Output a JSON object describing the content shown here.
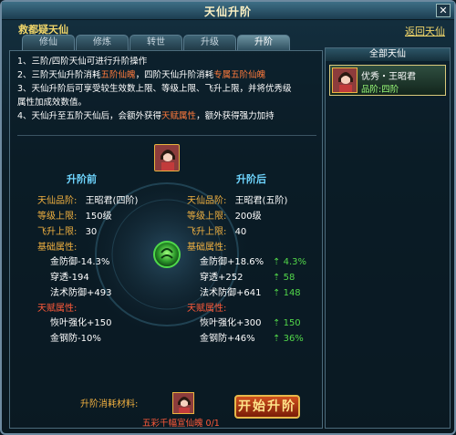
{
  "window": {
    "title": "天仙升阶",
    "close_glyph": "✕"
  },
  "header": {
    "label": "救都疑天仙",
    "return_link": "返回天仙"
  },
  "tabs": [
    {
      "label": "修仙"
    },
    {
      "label": "修炼"
    },
    {
      "label": "转世"
    },
    {
      "label": "升级"
    },
    {
      "label": "升阶"
    }
  ],
  "rules": [
    {
      "a": "1、三阶/四阶天仙可进行升阶操作",
      "hl": "",
      "c": ""
    },
    {
      "a": "2、三阶天仙升阶消耗",
      "hl": "五阶仙魄",
      "c": "，四阶天仙升阶消耗",
      "hl2": "专属五阶仙魄"
    },
    {
      "a": "3、天仙升阶后可享受较生效数上限、等级上限、飞升上限，并将优秀级",
      "hl": "",
      "c": ""
    },
    {
      "a": "属性加成效数值。",
      "hl": "",
      "c": ""
    },
    {
      "a": "4、天仙升至五阶天仙后，会额外获得",
      "hl": "天赋属性",
      "c": "，额外获得强力加持"
    }
  ],
  "before": {
    "header": "升阶前",
    "rows": [
      {
        "label": "天仙品阶:",
        "value": "王昭君(四阶)"
      },
      {
        "label": "等级上限:",
        "value": "150级"
      },
      {
        "label": "飞升上限:",
        "value": "30"
      }
    ],
    "base_title": "基础属性:",
    "base": [
      "金防御-14.3%",
      "穿透-194",
      "法术防御+493"
    ],
    "talent_title": "天赋属性:",
    "talent": [
      "恢叶强化+150",
      "金钢防-10%"
    ]
  },
  "after": {
    "header": "升阶后",
    "rows": [
      {
        "label": "天仙品阶:",
        "value": "王昭君(五阶)"
      },
      {
        "label": "等级上限:",
        "value": "200级"
      },
      {
        "label": "飞升上限:",
        "value": "40"
      }
    ],
    "base_title": "基础属性:",
    "base": [
      {
        "value": "金防御+18.6%",
        "delta": "4.3%"
      },
      {
        "value": "穿透+252",
        "delta": "58"
      },
      {
        "value": "法术防御+641",
        "delta": "148"
      }
    ],
    "talent_title": "天赋属性:",
    "talent": [
      {
        "value": "恢叶强化+300",
        "delta": "150"
      },
      {
        "value": "金钢防+46%",
        "delta": "36%"
      }
    ]
  },
  "side": {
    "header": "全部天仙",
    "item": {
      "name": "优秀・王昭君",
      "grade": "品阶:四阶"
    }
  },
  "material": {
    "label": "升阶消耗材料:",
    "name": "五彩千幅宣仙魄 0/1"
  },
  "start_button": "开始升阶",
  "colors": {
    "gold": "#f0b040",
    "cyan": "#6fd6ff",
    "green": "#52d74a",
    "red": "#ff5a3a"
  }
}
